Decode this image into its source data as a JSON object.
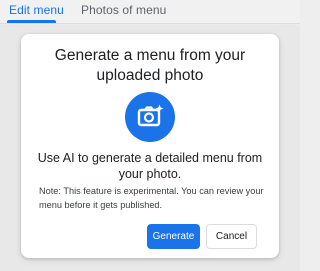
{
  "tabs": [
    {
      "label": "Edit menu",
      "active": true
    },
    {
      "label": "Photos of menu",
      "active": false
    }
  ],
  "dialog": {
    "title": "Generate a menu from your uploaded photo",
    "icon": "camera-sparkle-icon",
    "description": "Use AI to generate a detailed menu from your photo.",
    "note": "Note: This feature is experimental. You can review your menu before it gets published.",
    "generate_label": "Generate",
    "cancel_label": "Cancel"
  },
  "colors": {
    "accent": "#1a73e8",
    "text": "#202124",
    "muted": "#5f6368",
    "dialog_bg": "#ffffff",
    "backdrop": "#e8e8e8"
  }
}
